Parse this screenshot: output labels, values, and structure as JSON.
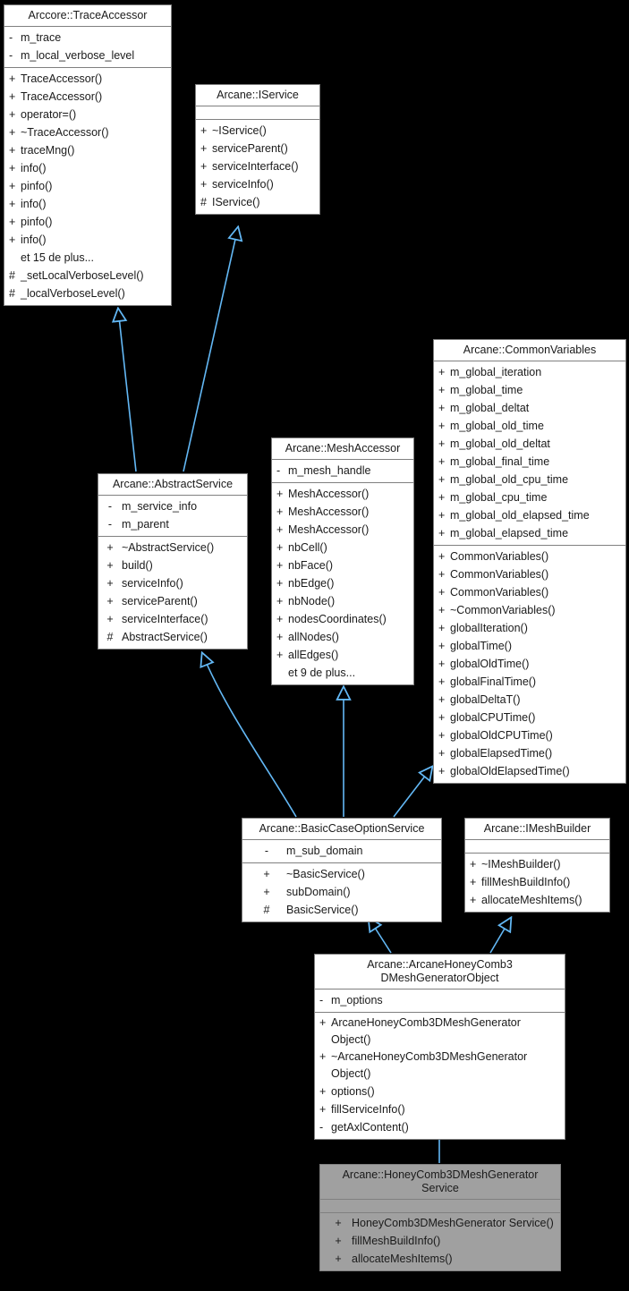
{
  "diagram": {
    "kind": "uml-inheritance-graph",
    "background_color": "#000000",
    "node_fill": "#ffffff",
    "node_border": "#808080",
    "highlight_fill": "#a0a0a0",
    "edge_color": "#63b8f5",
    "text_color": "#1a1a1a"
  },
  "nodes": {
    "trace_accessor": {
      "title": "Arccore::TraceAccessor",
      "attributes": [
        {
          "vis": "-",
          "name": "m_trace"
        },
        {
          "vis": "-",
          "name": "m_local_verbose_level"
        }
      ],
      "methods": [
        {
          "vis": "+",
          "name": "TraceAccessor()"
        },
        {
          "vis": "+",
          "name": "TraceAccessor()"
        },
        {
          "vis": "+",
          "name": "operator=()"
        },
        {
          "vis": "+",
          "name": "~TraceAccessor()"
        },
        {
          "vis": "+",
          "name": "traceMng()"
        },
        {
          "vis": "+",
          "name": "info()"
        },
        {
          "vis": "+",
          "name": "pinfo()"
        },
        {
          "vis": "+",
          "name": "info()"
        },
        {
          "vis": "+",
          "name": "pinfo()"
        },
        {
          "vis": "+",
          "name": "info()"
        },
        {
          "vis": "",
          "name": "et 15 de plus..."
        },
        {
          "vis": "#",
          "name": "_setLocalVerboseLevel()"
        },
        {
          "vis": "#",
          "name": "_localVerboseLevel()"
        }
      ]
    },
    "iservice": {
      "title": "Arcane::IService",
      "attributes": [],
      "methods": [
        {
          "vis": "+",
          "name": "~IService()"
        },
        {
          "vis": "+",
          "name": "serviceParent()"
        },
        {
          "vis": "+",
          "name": "serviceInterface()"
        },
        {
          "vis": "+",
          "name": "serviceInfo()"
        },
        {
          "vis": "#",
          "name": "IService()"
        }
      ]
    },
    "abstract_service": {
      "title": "Arcane::AbstractService",
      "attributes": [
        {
          "vis": "-",
          "name": "m_service_info"
        },
        {
          "vis": "-",
          "name": "m_parent"
        }
      ],
      "methods": [
        {
          "vis": "+",
          "name": "~AbstractService()"
        },
        {
          "vis": "+",
          "name": "build()"
        },
        {
          "vis": "+",
          "name": "serviceInfo()"
        },
        {
          "vis": "+",
          "name": "serviceParent()"
        },
        {
          "vis": "+",
          "name": "serviceInterface()"
        },
        {
          "vis": "#",
          "name": "AbstractService()"
        }
      ]
    },
    "mesh_accessor": {
      "title": "Arcane::MeshAccessor",
      "attributes": [
        {
          "vis": "-",
          "name": "m_mesh_handle"
        }
      ],
      "methods": [
        {
          "vis": "+",
          "name": "MeshAccessor()"
        },
        {
          "vis": "+",
          "name": "MeshAccessor()"
        },
        {
          "vis": "+",
          "name": "MeshAccessor()"
        },
        {
          "vis": "+",
          "name": "nbCell()"
        },
        {
          "vis": "+",
          "name": "nbFace()"
        },
        {
          "vis": "+",
          "name": "nbEdge()"
        },
        {
          "vis": "+",
          "name": "nbNode()"
        },
        {
          "vis": "+",
          "name": "nodesCoordinates()"
        },
        {
          "vis": "+",
          "name": "allNodes()"
        },
        {
          "vis": "+",
          "name": "allEdges()"
        },
        {
          "vis": "",
          "name": "et 9 de plus..."
        }
      ]
    },
    "common_variables": {
      "title": "Arcane::CommonVariables",
      "attributes": [
        {
          "vis": "+",
          "name": "m_global_iteration"
        },
        {
          "vis": "+",
          "name": "m_global_time"
        },
        {
          "vis": "+",
          "name": "m_global_deltat"
        },
        {
          "vis": "+",
          "name": "m_global_old_time"
        },
        {
          "vis": "+",
          "name": "m_global_old_deltat"
        },
        {
          "vis": "+",
          "name": "m_global_final_time"
        },
        {
          "vis": "+",
          "name": "m_global_old_cpu_time"
        },
        {
          "vis": "+",
          "name": "m_global_cpu_time"
        },
        {
          "vis": "+",
          "name": "m_global_old_elapsed_time"
        },
        {
          "vis": "+",
          "name": "m_global_elapsed_time"
        }
      ],
      "methods": [
        {
          "vis": "+",
          "name": "CommonVariables()"
        },
        {
          "vis": "+",
          "name": "CommonVariables()"
        },
        {
          "vis": "+",
          "name": "CommonVariables()"
        },
        {
          "vis": "+",
          "name": "~CommonVariables()"
        },
        {
          "vis": "+",
          "name": "globalIteration()"
        },
        {
          "vis": "+",
          "name": "globalTime()"
        },
        {
          "vis": "+",
          "name": "globalOldTime()"
        },
        {
          "vis": "+",
          "name": "globalFinalTime()"
        },
        {
          "vis": "+",
          "name": "globalDeltaT()"
        },
        {
          "vis": "+",
          "name": "globalCPUTime()"
        },
        {
          "vis": "+",
          "name": "globalOldCPUTime()"
        },
        {
          "vis": "+",
          "name": "globalElapsedTime()"
        },
        {
          "vis": "+",
          "name": "globalOldElapsedTime()"
        }
      ]
    },
    "basic_case_option_service": {
      "title": "Arcane::BasicCaseOptionService",
      "attributes": [
        {
          "vis": "-",
          "name": "m_sub_domain"
        }
      ],
      "methods": [
        {
          "vis": "+",
          "name": "~BasicService()"
        },
        {
          "vis": "+",
          "name": "subDomain()"
        },
        {
          "vis": "#",
          "name": "BasicService()"
        }
      ]
    },
    "imesh_builder": {
      "title": "Arcane::IMeshBuilder",
      "attributes": [],
      "methods": [
        {
          "vis": "+",
          "name": "~IMeshBuilder()"
        },
        {
          "vis": "+",
          "name": "fillMeshBuildInfo()"
        },
        {
          "vis": "+",
          "name": "allocateMeshItems()"
        }
      ]
    },
    "honeycomb_object": {
      "title": "Arcane::ArcaneHoneyComb3\nDMeshGeneratorObject",
      "attributes": [
        {
          "vis": "-",
          "name": "m_options"
        }
      ],
      "methods": [
        {
          "vis": "+",
          "name": "ArcaneHoneyComb3DMeshGenerator Object()"
        },
        {
          "vis": "+",
          "name": "~ArcaneHoneyComb3DMeshGenerator Object()"
        },
        {
          "vis": "+",
          "name": "options()"
        },
        {
          "vis": "+",
          "name": "fillServiceInfo()"
        },
        {
          "vis": "-",
          "name": "getAxlContent()"
        }
      ]
    },
    "honeycomb_service": {
      "title": "Arcane::HoneyComb3DMeshGenerator\nService",
      "attributes": [],
      "methods": [
        {
          "vis": "+",
          "name": "HoneyComb3DMeshGenerator Service()"
        },
        {
          "vis": "+",
          "name": "fillMeshBuildInfo()"
        },
        {
          "vis": "+",
          "name": "allocateMeshItems()"
        }
      ]
    }
  },
  "edges": [
    {
      "from": "abstract_service",
      "to": "trace_accessor",
      "type": "inheritance"
    },
    {
      "from": "abstract_service",
      "to": "iservice",
      "type": "inheritance"
    },
    {
      "from": "basic_case_option_service",
      "to": "abstract_service",
      "type": "inheritance"
    },
    {
      "from": "basic_case_option_service",
      "to": "mesh_accessor",
      "type": "inheritance"
    },
    {
      "from": "basic_case_option_service",
      "to": "common_variables",
      "type": "inheritance"
    },
    {
      "from": "honeycomb_object",
      "to": "basic_case_option_service",
      "type": "inheritance"
    },
    {
      "from": "honeycomb_object",
      "to": "imesh_builder",
      "type": "inheritance"
    },
    {
      "from": "honeycomb_service",
      "to": "honeycomb_object",
      "type": "inheritance"
    }
  ]
}
